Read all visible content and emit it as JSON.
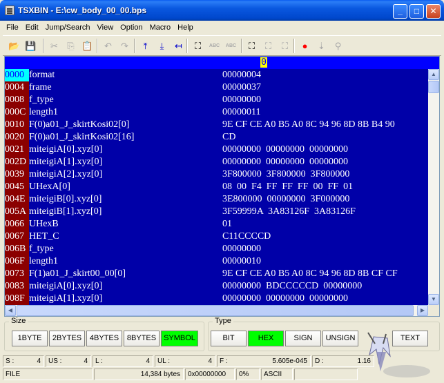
{
  "window": {
    "title": "TSXBIN - E:\\cw_body_00_00.bps",
    "minimize_glyph": "_",
    "maximize_glyph": "□",
    "close_glyph": "✕"
  },
  "menu": [
    "File",
    "Edit",
    "Jump/Search",
    "View",
    "Option",
    "Macro",
    "Help"
  ],
  "toolbar": {
    "tools": [
      {
        "name": "open-folder-icon",
        "glyph": "📂",
        "enabled": true
      },
      {
        "name": "save-icon",
        "glyph": "💾",
        "enabled": false
      },
      {
        "name": "cut-icon",
        "glyph": "✂",
        "enabled": false
      },
      {
        "name": "copy-icon",
        "glyph": "⎘",
        "enabled": false
      },
      {
        "name": "paste-icon",
        "glyph": "📋",
        "enabled": false
      },
      {
        "name": "undo-icon",
        "glyph": "↶",
        "enabled": false
      },
      {
        "name": "redo-icon",
        "glyph": "↷",
        "enabled": false
      },
      {
        "name": "jump-top-icon",
        "glyph": "⤒",
        "enabled": true
      },
      {
        "name": "jump-bottom-icon",
        "glyph": "⤓",
        "enabled": true
      },
      {
        "name": "jump-return-icon",
        "glyph": "↤",
        "enabled": true
      },
      {
        "name": "search-binoculars-icon",
        "glyph": "⛶",
        "enabled": true
      },
      {
        "name": "search-abc-icon",
        "glyph": "ABC",
        "enabled": false
      },
      {
        "name": "search-abc-next-icon",
        "glyph": "ABC",
        "enabled": false
      },
      {
        "name": "find-icon",
        "glyph": "⛶",
        "enabled": true
      },
      {
        "name": "find-next-icon",
        "glyph": "⛶",
        "enabled": false
      },
      {
        "name": "find-prev-icon",
        "glyph": "⛶",
        "enabled": false
      },
      {
        "name": "record-macro-icon",
        "glyph": "●",
        "enabled": true
      },
      {
        "name": "macro-step-icon",
        "glyph": "⇣",
        "enabled": false
      },
      {
        "name": "macro-run-icon",
        "glyph": "⚲",
        "enabled": false
      }
    ]
  },
  "hex": {
    "cursor_char": "0",
    "rows": [
      {
        "addr": "0000",
        "name": "format",
        "value": "00000004",
        "selected": true
      },
      {
        "addr": "0004",
        "name": "frame",
        "value": "00000037"
      },
      {
        "addr": "0008",
        "name": "f_type",
        "value": "00000000"
      },
      {
        "addr": "000C",
        "name": "length1",
        "value": "00000011"
      },
      {
        "addr": "0010",
        "name": "F(0)a01_J_skirtKosi02[0]",
        "value": "9E CF CE A0 B5 A0 8C 94 96 8D 8B B4 90"
      },
      {
        "addr": "0020",
        "name": "F(0)a01_J_skirtKosi02[16]",
        "value": "CD"
      },
      {
        "addr": "0021",
        "name": "miteigiA[0].xyz[0]",
        "value": "00000000  00000000  00000000"
      },
      {
        "addr": "002D",
        "name": "miteigiA[1].xyz[0]",
        "value": "00000000  00000000  00000000"
      },
      {
        "addr": "0039",
        "name": "miteigiA[2].xyz[0]",
        "value": "3F800000  3F800000  3F800000"
      },
      {
        "addr": "0045",
        "name": "UHexA[0]",
        "value": "08  00  F4  FF  FF  FF  00  FF  01"
      },
      {
        "addr": "004E",
        "name": "miteigiB[0].xyz[0]",
        "value": "3E800000  00000000  3F000000"
      },
      {
        "addr": "005A",
        "name": "miteigiB[1].xyz[0]",
        "value": "3F59999A  3A83126F  3A83126F"
      },
      {
        "addr": "0066",
        "name": "UHexB",
        "value": "01"
      },
      {
        "addr": "0067",
        "name": "HET_C",
        "value": "C11CCCCD"
      },
      {
        "addr": "006B",
        "name": "f_type",
        "value": "00000000"
      },
      {
        "addr": "006F",
        "name": "length1",
        "value": "00000010"
      },
      {
        "addr": "0073",
        "name": "F(1)a01_J_skirt00_00[0]",
        "value": "9E CF CE A0 B5 A0 8C 94 96 8D 8B CF CF"
      },
      {
        "addr": "0083",
        "name": "miteigiA[0].xyz[0]",
        "value": "00000000  BDCCCCCD  00000000"
      },
      {
        "addr": "008F",
        "name": "miteigiA[1].xyz[0]",
        "value": "00000000  00000000  00000000"
      }
    ]
  },
  "size_group": {
    "label": "Size",
    "buttons": [
      {
        "label": "1BYTE",
        "active": false
      },
      {
        "label": "2BYTES",
        "active": false
      },
      {
        "label": "4BYTES",
        "active": false
      },
      {
        "label": "8BYTES",
        "active": false
      },
      {
        "label": "SYMBOL",
        "active": true
      }
    ]
  },
  "type_group": {
    "label": "Type",
    "buttons": [
      {
        "label": "BIT",
        "active": false
      },
      {
        "label": "HEX",
        "active": true
      },
      {
        "label": "SIGN",
        "active": false
      },
      {
        "label": "UNSIGN",
        "active": false
      }
    ],
    "text_button": "TEXT"
  },
  "status1": [
    {
      "label": "S :",
      "value": "4"
    },
    {
      "label": "US :",
      "value": "4"
    },
    {
      "label": "L :",
      "value": "4"
    },
    {
      "label": "UL :",
      "value": "4"
    },
    {
      "label": "F :",
      "value": "5.605e-045"
    },
    {
      "label": "D :",
      "value": "1.16"
    }
  ],
  "status2": {
    "mode": "FILE",
    "size": "14,384 bytes",
    "offset": "0x00000000",
    "percent": "0%",
    "encoding": "ASCII"
  },
  "colors": {
    "hex_bg": "#0000a8",
    "ruler_bg": "#0000ff",
    "address_bg": "#8b0000",
    "selected_address_bg": "#00ffff",
    "active_button": "#00ff00",
    "record_red": "#ff0000"
  }
}
